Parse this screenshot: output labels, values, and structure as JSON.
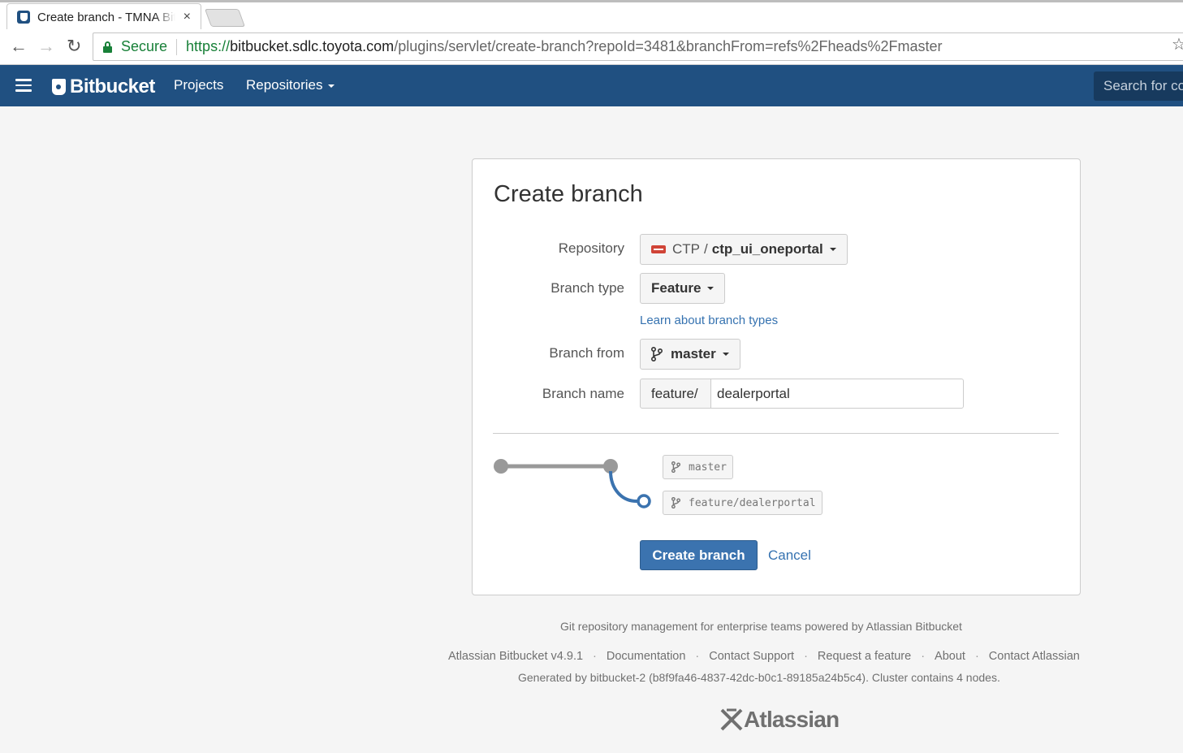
{
  "browser": {
    "tab_title": "Create branch - TMNA Bitbucket",
    "tab_close": "×",
    "secure_label": "Secure",
    "url_scheme": "https://",
    "url_host": "bitbucket.sdlc.toyota.com",
    "url_path": "/plugins/servlet/create-branch?repoId=3481&branchFrom=refs%2Fheads%2Fmaster",
    "back_icon": "←",
    "forward_icon": "→",
    "reload_icon": "↻",
    "star_icon": "☆"
  },
  "header": {
    "logo_text": "Bitbucket",
    "nav_projects": "Projects",
    "nav_repositories": "Repositories",
    "search_placeholder": "Search for code"
  },
  "form": {
    "title": "Create branch",
    "repository_label": "Repository",
    "project_key": "CTP",
    "repo_slash": "/",
    "repo_name": "ctp_ui_oneportal",
    "branch_type_label": "Branch type",
    "branch_type_value": "Feature",
    "learn_link": "Learn about branch types",
    "branch_from_label": "Branch from",
    "branch_from_value": "master",
    "branch_name_label": "Branch name",
    "branch_prefix": "feature/",
    "branch_name_value": "dealerportal",
    "create_button": "Create branch",
    "cancel_link": "Cancel"
  },
  "diagram": {
    "source_ref": "master",
    "new_ref": "feature/dealerportal"
  },
  "footer": {
    "tagline": "Git repository management for enterprise teams powered by Atlassian Bitbucket",
    "links": [
      "Atlassian Bitbucket v4.9.1",
      "Documentation",
      "Contact Support",
      "Request a feature",
      "About",
      "Contact Atlassian"
    ],
    "separator": "·",
    "generated": "Generated by bitbucket-2 (b8f9fa46-4837-42dc-b0c1-89185a24b5c4). Cluster contains 4 nodes.",
    "atlassian_logo": "Atlassian"
  },
  "colors": {
    "header_bg": "#205081",
    "primary_button": "#3b73af",
    "link": "#3572b0",
    "branch_line": "#3b73af"
  }
}
